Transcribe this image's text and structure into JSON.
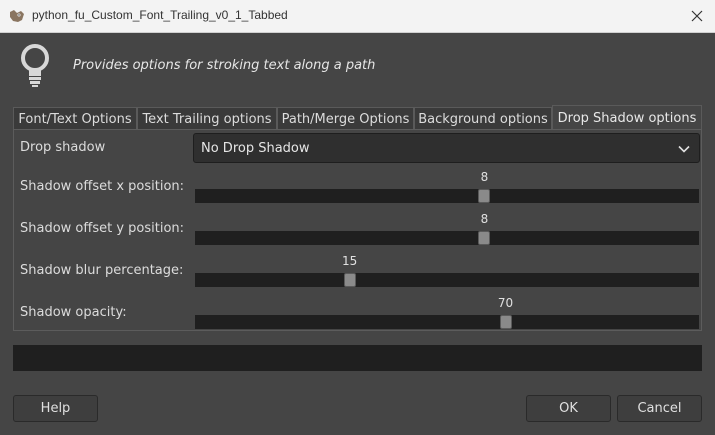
{
  "window": {
    "title": "python_fu_Custom_Font_Trailing_v0_1_Tabbed"
  },
  "header": {
    "icon": "lightbulb-icon",
    "description": "Provides options for stroking text along a path"
  },
  "tabs": [
    {
      "label": "Font/Text Options"
    },
    {
      "label": "Text Trailing options"
    },
    {
      "label": "Path/Merge Options"
    },
    {
      "label": "Background options"
    },
    {
      "label": "Drop Shadow options"
    }
  ],
  "active_tab": "Drop Shadow options",
  "drop_shadow": {
    "label": "Drop shadow",
    "value": "No Drop Shadow"
  },
  "sliders": [
    {
      "label": "Shadow offset x position:",
      "value": "8",
      "fraction": 0.576
    },
    {
      "label": "Shadow offset y position:",
      "value": "8",
      "fraction": 0.576
    },
    {
      "label": "Shadow blur percentage:",
      "value": "15",
      "fraction": 0.302
    },
    {
      "label": "Shadow opacity:",
      "value": "70",
      "fraction": 0.619
    }
  ],
  "buttons": {
    "help": "Help",
    "ok": "OK",
    "cancel": "Cancel"
  },
  "colors": {
    "background": "#454545",
    "trough": "#1f1f1f",
    "handle": "#8a8a8a"
  }
}
